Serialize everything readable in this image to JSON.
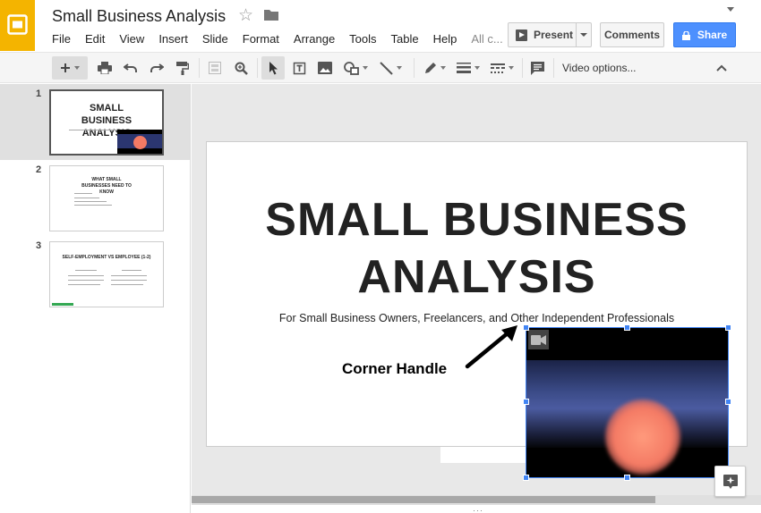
{
  "app": {
    "title": "Small Business Analysis",
    "menu": [
      "File",
      "Edit",
      "View",
      "Insert",
      "Slide",
      "Format",
      "Arrange",
      "Tools",
      "Table",
      "Help",
      "All c..."
    ],
    "present_label": "Present",
    "comments_label": "Comments",
    "share_label": "Share",
    "brand_color": "#f4b400",
    "accent_color": "#4285f4"
  },
  "toolbar": {
    "video_options_label": "Video options...",
    "icons": [
      "plus-icon",
      "print-icon",
      "undo-icon",
      "redo-icon",
      "paint-format-icon",
      "placeholder-icon",
      "zoom-icon",
      "select-icon",
      "text-box-icon",
      "image-icon",
      "shape-icon",
      "line-icon",
      "pen-icon",
      "line-weight-icon",
      "line-dash-icon",
      "comment-icon",
      "collapse-icon"
    ]
  },
  "filmstrip": {
    "slides": [
      {
        "number": "1",
        "title": "SMALL BUSINESS ANALYSIS"
      },
      {
        "number": "2",
        "title": "WHAT SMALL BUSINESSES NEED TO KNOW"
      },
      {
        "number": "3",
        "title": "SELF-EMPLOYMENT VS EMPLOYEE (1-2)"
      }
    ]
  },
  "slide": {
    "title_line1": "SMALL BUSINESS",
    "title_line2": "ANALYSIS",
    "subtitle": "For Small Business Owners, Freelancers, and Other Independent Professionals"
  },
  "annotation": {
    "label": "Corner Handle"
  }
}
